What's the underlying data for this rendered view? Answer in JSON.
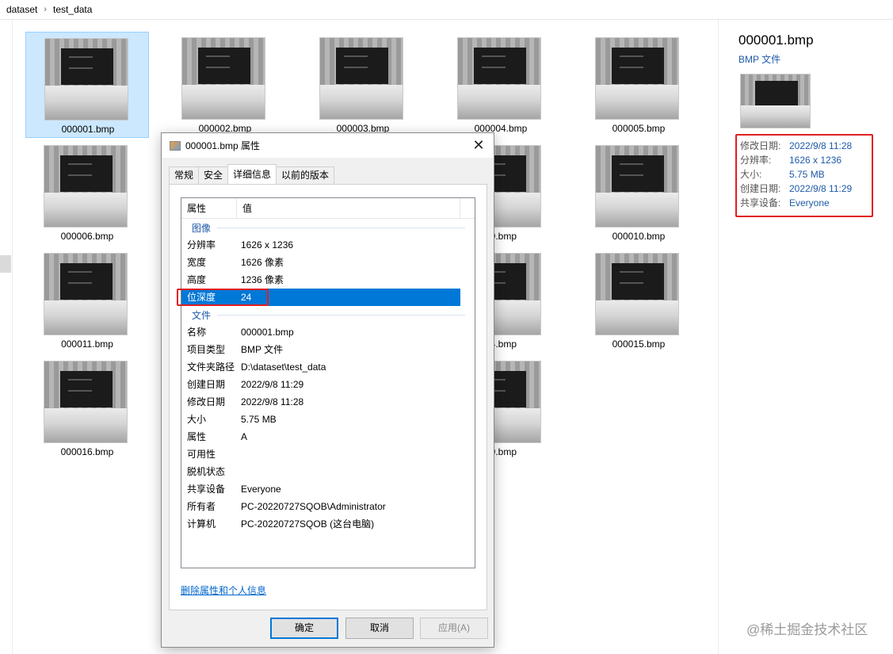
{
  "breadcrumb": [
    "dataset",
    "test_data"
  ],
  "files": [
    "000001.bmp",
    "000002.bmp",
    "000003.bmp",
    "000004.bmp",
    "000005.bmp",
    "000006.bmp",
    "09.bmp",
    "000010.bmp",
    "000011.bmp",
    "14.bmp",
    "000015.bmp",
    "000016.bmp",
    "19.bmp"
  ],
  "preview": {
    "title": "000001.bmp",
    "type": "BMP 文件",
    "props": [
      {
        "k": "修改日期:",
        "v": "2022/9/8 11:28"
      },
      {
        "k": "分辨率:",
        "v": "1626 x 1236"
      },
      {
        "k": "大小:",
        "v": "5.75 MB"
      },
      {
        "k": "创建日期:",
        "v": "2022/9/8 11:29"
      },
      {
        "k": "共享设备:",
        "v": "Everyone"
      }
    ]
  },
  "dialog": {
    "title": "000001.bmp 属性",
    "close": "✕",
    "tabs": [
      "常规",
      "安全",
      "详细信息",
      "以前的版本"
    ],
    "header": {
      "col1": "属性",
      "col2": "值"
    },
    "groups": {
      "image": "图像",
      "file": "文件"
    },
    "image_rows": [
      {
        "k": "分辨率",
        "v": "1626 x 1236"
      },
      {
        "k": "宽度",
        "v": "1626 像素"
      },
      {
        "k": "高度",
        "v": "1236 像素"
      },
      {
        "k": "位深度",
        "v": "24"
      }
    ],
    "file_rows": [
      {
        "k": "名称",
        "v": "000001.bmp"
      },
      {
        "k": "项目类型",
        "v": "BMP 文件"
      },
      {
        "k": "文件夹路径",
        "v": "D:\\dataset\\test_data"
      },
      {
        "k": "创建日期",
        "v": "2022/9/8 11:29"
      },
      {
        "k": "修改日期",
        "v": "2022/9/8 11:28"
      },
      {
        "k": "大小",
        "v": "5.75 MB"
      },
      {
        "k": "属性",
        "v": "A"
      },
      {
        "k": "可用性",
        "v": ""
      },
      {
        "k": "脱机状态",
        "v": ""
      },
      {
        "k": "共享设备",
        "v": "Everyone"
      },
      {
        "k": "所有者",
        "v": "PC-20220727SQOB\\Administrator"
      },
      {
        "k": "计算机",
        "v": "PC-20220727SQOB (这台电脑)"
      }
    ],
    "remove_link": "删除属性和个人信息",
    "buttons": {
      "ok": "确定",
      "cancel": "取消",
      "apply": "应用(A)"
    }
  },
  "watermark": "@稀土掘金技术社区"
}
